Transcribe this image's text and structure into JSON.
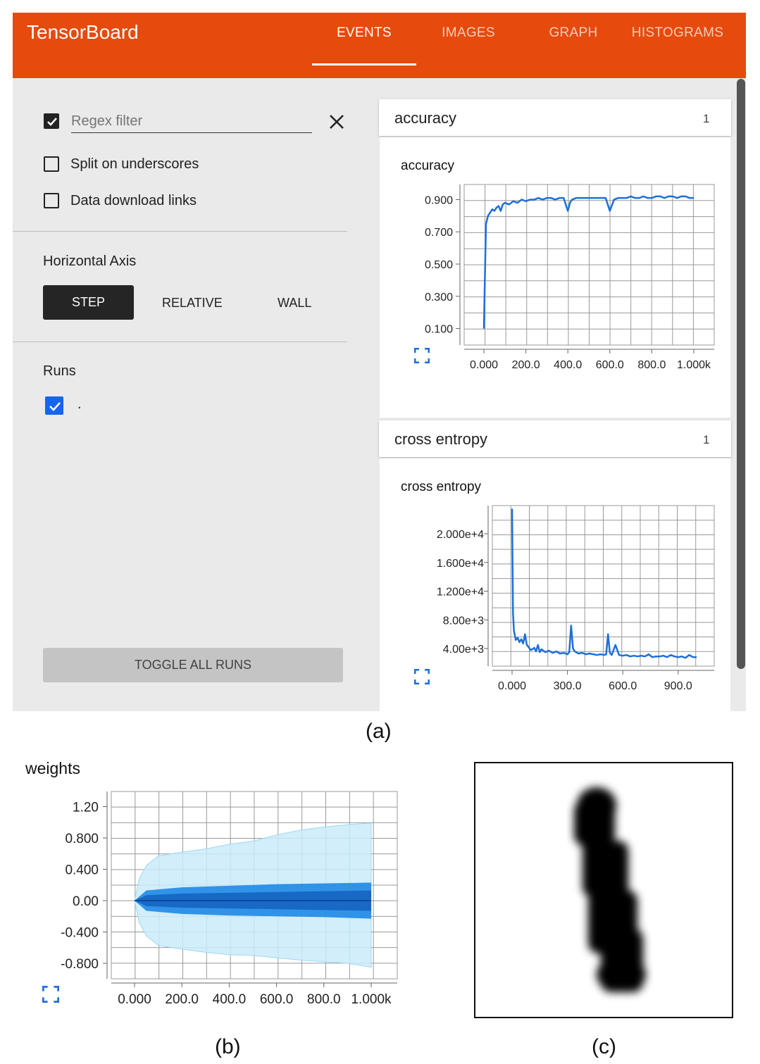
{
  "header": {
    "title": "TensorBoard",
    "tabs": [
      {
        "label": "EVENTS",
        "active": true
      },
      {
        "label": "IMAGES",
        "active": false
      },
      {
        "label": "GRAPH",
        "active": false
      },
      {
        "label": "HISTOGRAMS",
        "active": false
      }
    ],
    "color": "#e64a0c"
  },
  "sidebar": {
    "regex_filter": {
      "checked": true,
      "placeholder": "Regex filter"
    },
    "split_on_underscores": {
      "label": "Split on underscores",
      "checked": false
    },
    "data_download_links": {
      "label": "Data download links",
      "checked": false
    },
    "horizontal_axis": {
      "heading": "Horizontal Axis",
      "options": [
        "STEP",
        "RELATIVE",
        "WALL"
      ],
      "selected": "STEP"
    },
    "runs": {
      "heading": "Runs",
      "items": [
        {
          "label": ".",
          "checked": true
        }
      ]
    },
    "toggle_all_runs": "TOGGLE ALL RUNS"
  },
  "cards": [
    {
      "title": "accuracy",
      "count": "1",
      "chart_title": "accuracy"
    },
    {
      "title": "cross entropy",
      "count": "1",
      "chart_title": "cross entropy"
    }
  ],
  "weights_title": "weights",
  "captions": {
    "a": "(a)",
    "b": "(b)",
    "c": "(c)"
  },
  "chart_data": [
    {
      "type": "line",
      "title": "accuracy",
      "xlim": [
        0,
        1000
      ],
      "ylim": [
        0.0,
        1.0
      ],
      "xticks": [
        "0.000",
        "200.0",
        "400.0",
        "600.0",
        "800.0",
        "1.000k"
      ],
      "yticks": [
        "0.100",
        "0.300",
        "0.500",
        "0.700",
        "0.900"
      ],
      "color": "#1e6fd9",
      "series": [
        {
          "x": [
            0,
            10,
            20,
            30,
            40,
            50,
            60,
            70,
            80,
            90,
            100,
            120,
            140,
            160,
            180,
            200,
            220,
            240,
            260,
            280,
            300,
            320,
            340,
            360,
            380,
            400,
            410,
            420,
            440,
            460,
            480,
            500,
            520,
            540,
            560,
            580,
            600,
            620,
            640,
            660,
            680,
            700,
            720,
            740,
            760,
            780,
            800,
            820,
            840,
            860,
            880,
            900,
            920,
            940,
            960,
            980,
            1000
          ],
          "y": [
            0.1,
            0.75,
            0.8,
            0.82,
            0.84,
            0.83,
            0.85,
            0.86,
            0.83,
            0.87,
            0.88,
            0.87,
            0.89,
            0.88,
            0.9,
            0.89,
            0.9,
            0.9,
            0.91,
            0.9,
            0.91,
            0.91,
            0.9,
            0.91,
            0.91,
            0.83,
            0.88,
            0.9,
            0.91,
            0.91,
            0.91,
            0.91,
            0.91,
            0.91,
            0.91,
            0.91,
            0.83,
            0.9,
            0.91,
            0.91,
            0.91,
            0.92,
            0.91,
            0.91,
            0.92,
            0.91,
            0.91,
            0.92,
            0.92,
            0.91,
            0.92,
            0.92,
            0.91,
            0.92,
            0.92,
            0.91,
            0.91
          ]
        }
      ]
    },
    {
      "type": "line",
      "title": "cross entropy",
      "xlim": [
        0,
        1000
      ],
      "ylim": [
        0,
        25000
      ],
      "xticks": [
        "0.000",
        "300.0",
        "600.0",
        "900.0"
      ],
      "yticks": [
        "4.00e+3",
        "8.00e+3",
        "1.200e+4",
        "1.600e+4",
        "2.000e+4"
      ],
      "color": "#1e6fd9",
      "series": [
        {
          "x": [
            0,
            5,
            10,
            20,
            30,
            40,
            50,
            60,
            70,
            80,
            90,
            100,
            110,
            120,
            130,
            140,
            150,
            160,
            180,
            200,
            220,
            240,
            260,
            280,
            300,
            310,
            320,
            330,
            340,
            360,
            380,
            400,
            420,
            440,
            460,
            480,
            500,
            510,
            520,
            530,
            540,
            560,
            580,
            600,
            620,
            640,
            660,
            680,
            700,
            720,
            740,
            760,
            780,
            800,
            820,
            840,
            860,
            880,
            900,
            920,
            940,
            960,
            980,
            1000
          ],
          "y": [
            23500,
            9000,
            6500,
            5200,
            5500,
            4900,
            5300,
            4700,
            6000,
            4500,
            4200,
            3800,
            3900,
            4100,
            3600,
            4500,
            3500,
            3900,
            3500,
            3700,
            3400,
            3600,
            3300,
            3400,
            3200,
            3500,
            7200,
            4000,
            3600,
            3300,
            3400,
            3200,
            3300,
            3200,
            3100,
            3200,
            3100,
            3200,
            6000,
            3400,
            3100,
            4500,
            3100,
            3000,
            3100,
            2900,
            3000,
            2900,
            3000,
            2900,
            3200,
            2800,
            2900,
            2900,
            3000,
            2800,
            3100,
            2900,
            2800,
            2900,
            2700,
            3100,
            2800,
            2800
          ]
        }
      ]
    },
    {
      "type": "area",
      "title": "weights",
      "xlim": [
        0,
        1000
      ],
      "ylim": [
        -1.0,
        1.4
      ],
      "xticks": [
        "0.000",
        "200.0",
        "400.0",
        "600.0",
        "800.0",
        "1.000k"
      ],
      "yticks": [
        "-0.800",
        "-0.400",
        "0.00",
        "0.400",
        "0.800",
        "1.20"
      ],
      "series": [
        {
          "band": "outer",
          "x": [
            0,
            20,
            50,
            100,
            200,
            300,
            400,
            500,
            600,
            700,
            800,
            900,
            1000
          ],
          "upper": [
            0.0,
            0.28,
            0.45,
            0.57,
            0.62,
            0.66,
            0.72,
            0.76,
            0.84,
            0.9,
            0.94,
            0.97,
            0.99
          ],
          "lower": [
            0.0,
            -0.28,
            -0.45,
            -0.57,
            -0.62,
            -0.66,
            -0.69,
            -0.7,
            -0.73,
            -0.76,
            -0.78,
            -0.8,
            -0.85
          ],
          "color": "#c9ebf9"
        },
        {
          "band": "mid",
          "x": [
            0,
            50,
            200,
            400,
            600,
            800,
            1000
          ],
          "upper": [
            0.0,
            0.13,
            0.17,
            0.19,
            0.21,
            0.22,
            0.23
          ],
          "lower": [
            0.0,
            -0.13,
            -0.17,
            -0.19,
            -0.2,
            -0.21,
            -0.23
          ],
          "color": "#1e88e5"
        },
        {
          "band": "inner",
          "x": [
            0,
            50,
            200,
            400,
            600,
            800,
            1000
          ],
          "upper": [
            0.0,
            0.07,
            0.09,
            0.1,
            0.11,
            0.12,
            0.13
          ],
          "lower": [
            0.0,
            -0.07,
            -0.09,
            -0.1,
            -0.11,
            -0.12,
            -0.13
          ],
          "color": "#1565c0"
        }
      ]
    }
  ]
}
